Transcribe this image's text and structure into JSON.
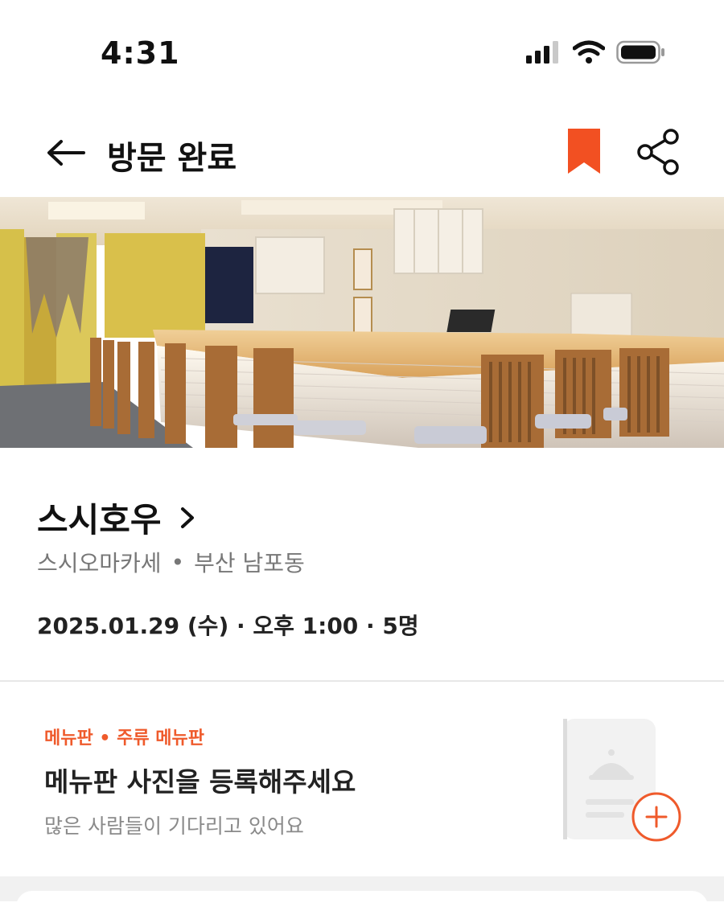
{
  "status_bar": {
    "time": "4:31",
    "icons": [
      "signal-icon",
      "wifi-icon",
      "battery-icon"
    ]
  },
  "header": {
    "title": "방문 완료",
    "back_icon": "back-arrow-icon",
    "bookmark_icon": "bookmark-icon",
    "share_icon": "share-icon",
    "bookmark_color": "#F25022"
  },
  "hero_image": "restaurant-interior-photo",
  "restaurant": {
    "name": "스시호우",
    "category": "스시오마카세",
    "separator": "•",
    "location": "부산 남포동",
    "visit": "2025.01.29 (수) · 오후 1:00 · 5명"
  },
  "menu_card": {
    "category": "메뉴판 • 주류 메뉴판",
    "title": "메뉴판 사진을 등록해주세요",
    "subtitle": "많은 사람들이 기다리고 있어요",
    "add_icon": "plus-circle-icon",
    "accent_color": "#EF5A2B"
  }
}
